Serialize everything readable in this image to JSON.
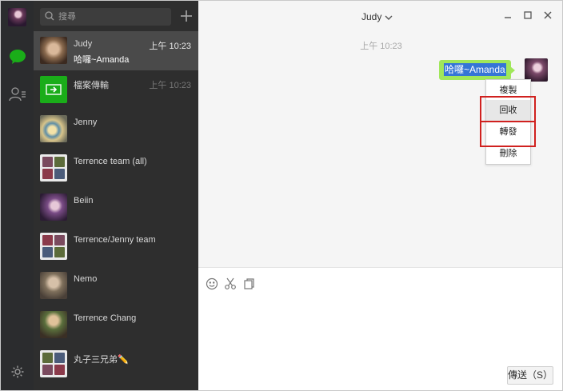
{
  "search": {
    "placeholder": "搜尋"
  },
  "conversations": [
    {
      "name": "Judy",
      "preview": "哈囉~Amanda",
      "time": "上午 10:23",
      "active": true
    },
    {
      "name": "檔案傳輸",
      "preview": "",
      "time": "上午 10:23"
    },
    {
      "name": "Jenny",
      "preview": "",
      "time": ""
    },
    {
      "name": "Terrence team (all)",
      "preview": "",
      "time": ""
    },
    {
      "name": "Beiin",
      "preview": "",
      "time": ""
    },
    {
      "name": "Terrence/Jenny team",
      "preview": "",
      "time": ""
    },
    {
      "name": "Nemo",
      "preview": "",
      "time": ""
    },
    {
      "name": "Terrence Chang",
      "preview": "",
      "time": ""
    },
    {
      "name": "丸子三兄弟✏️",
      "preview": "",
      "time": ""
    }
  ],
  "chat": {
    "title": "Judy",
    "timestamp": "上午 10:23",
    "message": "哈囉~Amanda"
  },
  "context_menu": {
    "items": [
      "複製",
      "回收",
      "轉發",
      "刪除"
    ],
    "hovered": "回收"
  },
  "compose": {
    "send_label": "傳送（S）"
  },
  "colors": {
    "sidebar": "#2e2e2e",
    "rail": "#2b2c2e",
    "brand_green": "#1aad19",
    "bubble_green": "#a0e75a",
    "selection_blue": "#3575d6",
    "highlight_red": "#d0211f"
  },
  "icons": {
    "rail": [
      "chat-icon",
      "contacts-icon",
      "settings-icon"
    ],
    "toolbar": [
      "emoji-icon",
      "scissors-icon",
      "file-icon"
    ]
  }
}
